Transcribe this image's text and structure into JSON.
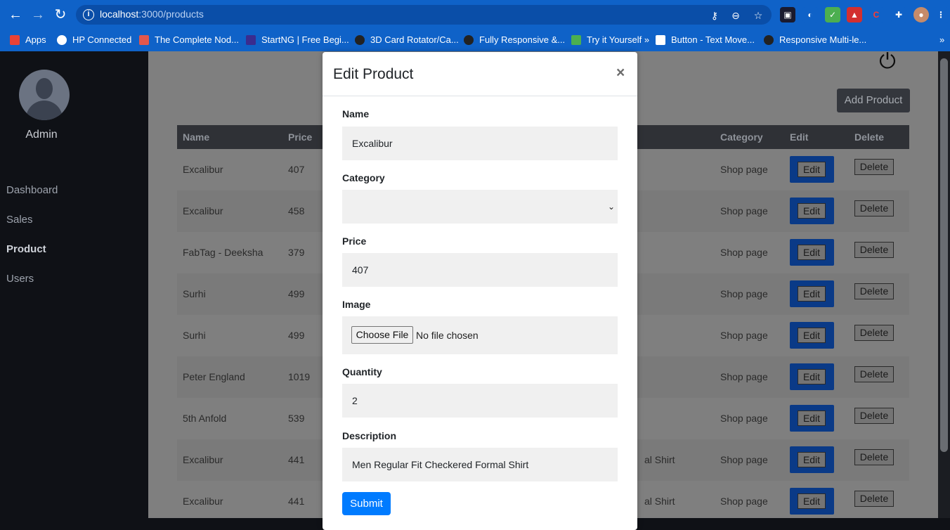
{
  "browser": {
    "url_host": "localhost",
    "url_path": ":3000/products",
    "bookmarks": [
      {
        "label": "Apps",
        "color": "#e94235"
      },
      {
        "label": "HP Connected",
        "color": "#ffffff"
      },
      {
        "label": "The Complete Nod...",
        "color": "#e2574c"
      },
      {
        "label": "StartNG | Free Begi...",
        "color": "#3a2c8f"
      },
      {
        "label": "3D Card Rotator/Ca...",
        "color": "#222222"
      },
      {
        "label": "Fully Responsive &...",
        "color": "#222222"
      },
      {
        "label": "Try it Yourself »",
        "color": "#4caf50"
      },
      {
        "label": "Button - Text Move...",
        "color": "#ffffff"
      },
      {
        "label": "Responsive Multi-le...",
        "color": "#222222"
      }
    ],
    "more": "»"
  },
  "sidebar": {
    "admin_name": "Admin",
    "items": [
      {
        "label": "Dashboard",
        "active": false
      },
      {
        "label": "Sales",
        "active": false
      },
      {
        "label": "Product",
        "active": true
      },
      {
        "label": "Users",
        "active": false
      }
    ]
  },
  "main": {
    "add_button": "Add Product",
    "columns": [
      "Name",
      "Price",
      "Category",
      "Edit",
      "Delete"
    ],
    "rows": [
      {
        "name": "Excalibur",
        "price": "407",
        "desc": "",
        "category": "Shop page"
      },
      {
        "name": "Excalibur",
        "price": "458",
        "desc": "",
        "category": "Shop page"
      },
      {
        "name": "FabTag - Deeksha",
        "price": "379",
        "desc": "",
        "category": "Shop page"
      },
      {
        "name": "Surhi",
        "price": "499",
        "desc": "",
        "category": "Shop page"
      },
      {
        "name": "Surhi",
        "price": "499",
        "desc": "",
        "category": "Shop page"
      },
      {
        "name": "Peter England",
        "price": "1019",
        "desc": "",
        "category": "Shop page"
      },
      {
        "name": "5th Anfold",
        "price": "539",
        "desc": "",
        "category": "Shop page"
      },
      {
        "name": "Excalibur",
        "price": "441",
        "desc": "al Shirt",
        "category": "Shop page"
      },
      {
        "name": "Excalibur",
        "price": "441",
        "desc": "al Shirt",
        "category": "Shop page"
      }
    ],
    "edit_label": "Edit",
    "delete_label": "Delete"
  },
  "modal": {
    "title": "Edit Product",
    "close": "×",
    "name_label": "Name",
    "name_value": "Excalibur",
    "category_label": "Category",
    "category_value": "",
    "price_label": "Price",
    "price_value": "407",
    "image_label": "Image",
    "choose_file": "Choose File",
    "no_file": "No file chosen",
    "quantity_label": "Quantity",
    "quantity_value": "2",
    "description_label": "Description",
    "description_value": "Men Regular Fit Checkered Formal Shirt",
    "submit": "Submit"
  }
}
